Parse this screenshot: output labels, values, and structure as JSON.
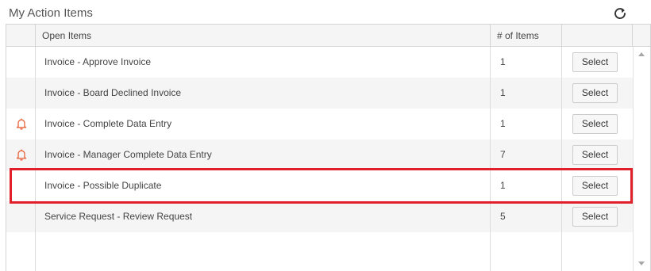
{
  "panel": {
    "title": "My Action Items",
    "refresh_icon": "refresh-icon"
  },
  "table": {
    "columns": [
      "",
      "Open Items",
      "# of Items",
      ""
    ],
    "rows": [
      {
        "name": "Invoice - Approve Invoice",
        "count": "1",
        "action": "Select",
        "alert": false
      },
      {
        "name": "Invoice - Board Declined Invoice",
        "count": "1",
        "action": "Select",
        "alert": false
      },
      {
        "name": "Invoice - Complete Data Entry",
        "count": "1",
        "action": "Select",
        "alert": true,
        "alert_icon": "bell-icon"
      },
      {
        "name": "Invoice - Manager Complete Data Entry",
        "count": "7",
        "action": "Select",
        "alert": true,
        "alert_icon": "bell-icon"
      },
      {
        "name": "Invoice - Possible Duplicate",
        "count": "1",
        "action": "Select",
        "alert": false,
        "highlighted": true
      },
      {
        "name": "Service Request - Review Request",
        "count": "5",
        "action": "Select",
        "alert": false
      }
    ]
  },
  "colors": {
    "alert_icon": "#e8643c",
    "highlight_border": "#e0202a",
    "alt_row": "#f5f5f5"
  }
}
